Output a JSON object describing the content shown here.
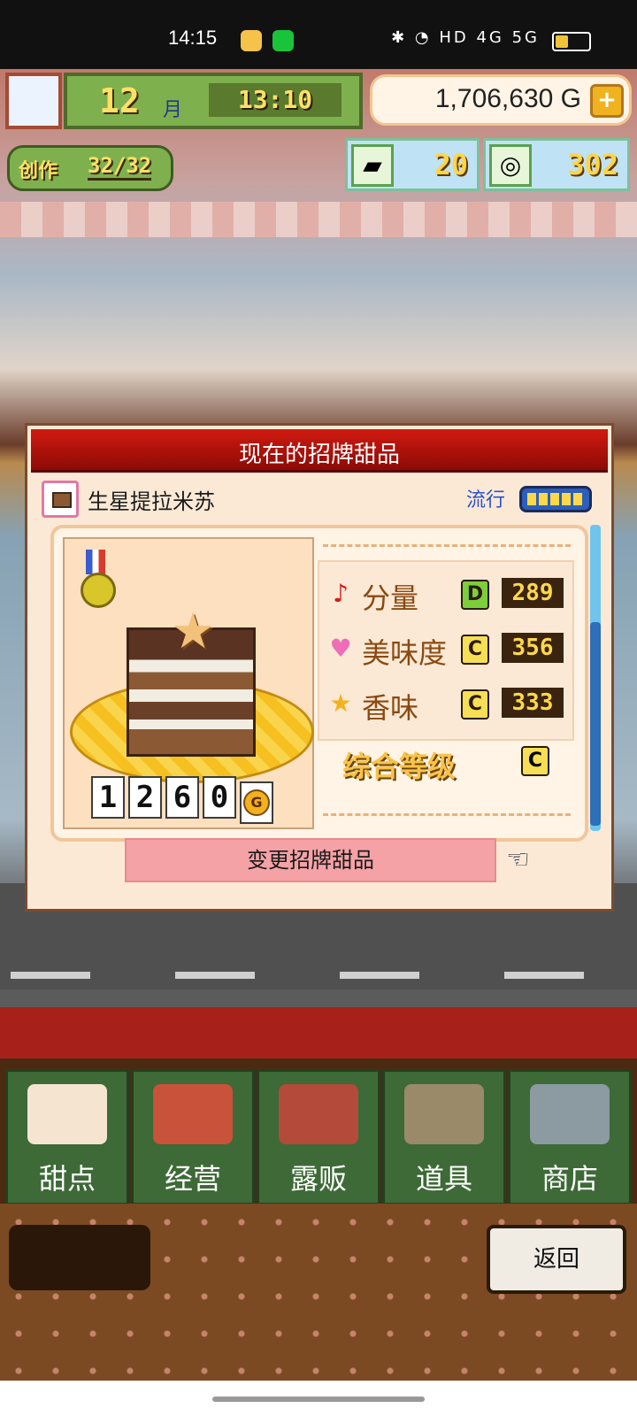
{
  "status_bar": {
    "time": "14:15",
    "right_icons": "✱ ◔ HD 4G 5G"
  },
  "hud": {
    "month_number": "12",
    "month_unit": "月",
    "clock": "13:10",
    "money": "1,706,630 G",
    "plus": "+",
    "create_label": "创作",
    "create_value": "32/32",
    "resource1_value": "20",
    "resource2_value": "302"
  },
  "dialog": {
    "title": "现在的招牌甜品",
    "item_name": "生星提拉米苏",
    "trend_label": "流行",
    "trend_level": 1.0,
    "price_digits": [
      "1",
      "2",
      "6",
      "0"
    ],
    "price_unit": "G",
    "stats": [
      {
        "label": "分量",
        "grade": "D",
        "value": "289",
        "icon": "music-note-icon",
        "color": "#d41c1c",
        "grade_color": "#7ccf3a"
      },
      {
        "label": "美味度",
        "grade": "C",
        "value": "356",
        "icon": "heart-icon",
        "color": "#f06cb6",
        "grade_color": "#f6df55"
      },
      {
        "label": "香味",
        "grade": "C",
        "value": "333",
        "icon": "star-icon",
        "color": "#f2b11d",
        "grade_color": "#f6df55"
      }
    ],
    "overall_label": "综合等级",
    "overall_grade": "C",
    "change_button": "变更招牌甜品"
  },
  "menu": {
    "items": [
      {
        "label": "甜点",
        "icon": "cake-icon"
      },
      {
        "label": "经营",
        "icon": "shop-icon"
      },
      {
        "label": "露贩",
        "icon": "food-truck-icon"
      },
      {
        "label": "道具",
        "icon": "gear-bag-icon"
      },
      {
        "label": "商店",
        "icon": "cart-icon"
      }
    ],
    "back_button": "返回"
  }
}
